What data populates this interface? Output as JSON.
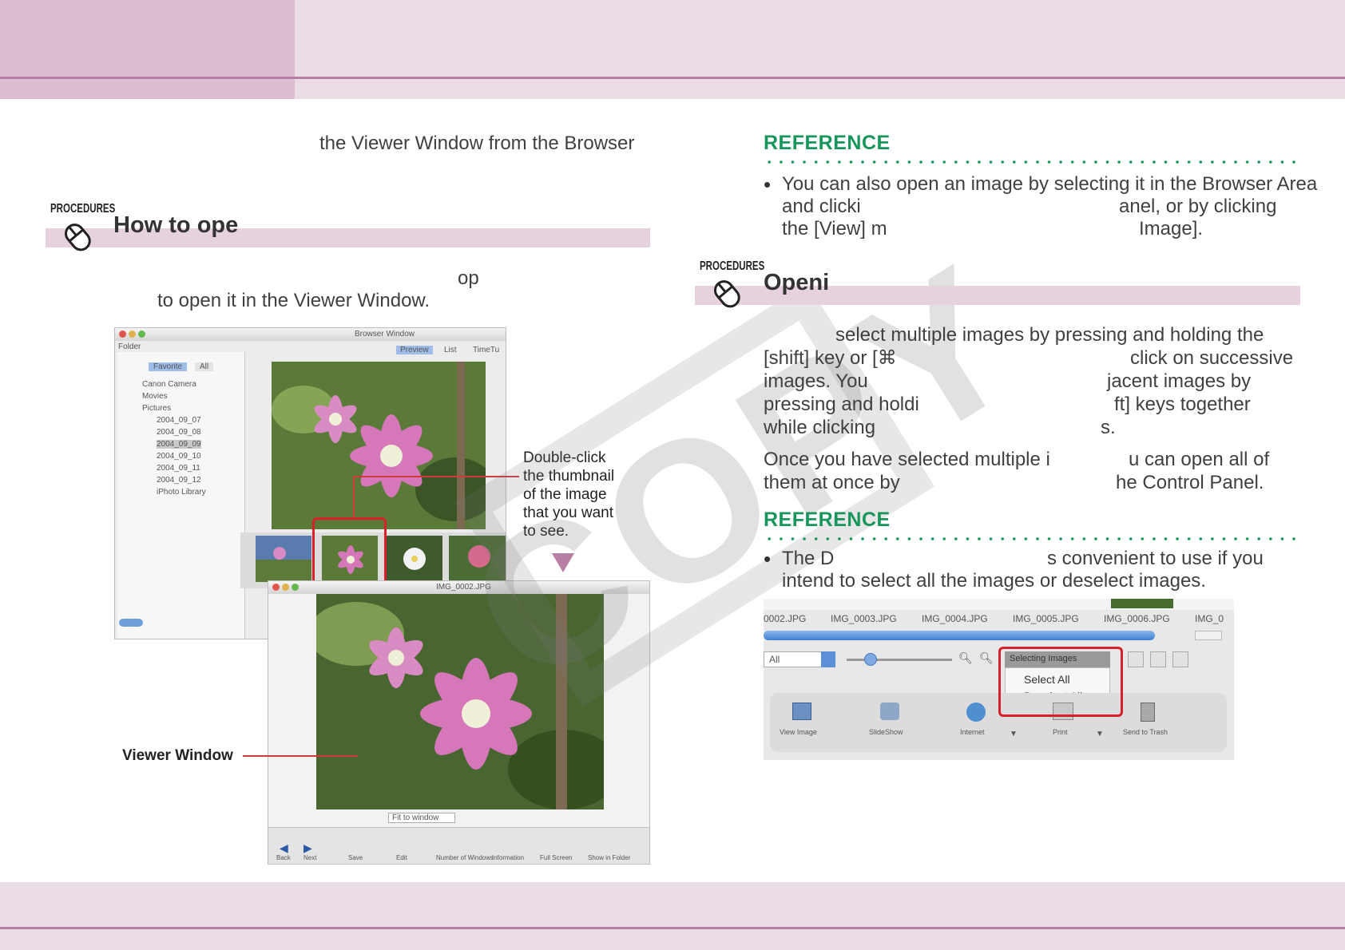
{
  "left": {
    "intro_line": "the Viewer Window from the Browser",
    "procedure_label": "PROCEDURES",
    "procedure_title": "How to ope",
    "step_line1": "op",
    "step_line2": "to open it in the Viewer Window.",
    "callout_thumbnail": "Double-click\nthe thumbnail\nof the image\nthat you want\nto see.",
    "callout_viewer": "Viewer Window",
    "browser_window": {
      "title": "Browser Window",
      "folder_label": "Folder",
      "tabs": [
        "Favorite",
        "All"
      ],
      "view_tabs": [
        "Preview",
        "List",
        "TimeTu"
      ],
      "tree": [
        "Canon Camera",
        "Movies",
        "Pictures",
        "2004_09_07",
        "2004_09_08",
        "2004_09_09",
        "2004_09_10",
        "2004_09_11",
        "2004_09_12",
        "iPhoto Library"
      ]
    },
    "viewer_window": {
      "title": "IMG_0002.JPG",
      "zoom": "Fit to window",
      "toolbar": [
        "Back",
        "Next",
        "Save",
        "Edit",
        "Number of Windows",
        "Information",
        "Full Screen",
        "Show in Folder"
      ]
    }
  },
  "right": {
    "reference1_title": "REFERENCE",
    "reference1_bullet": "•",
    "reference1_lines": [
      "You can also open an image by selecting it in the Browser Area",
      "and clicki",
      "anel, or by clicking",
      "the [View] m",
      "Image]."
    ],
    "procedure_label": "PROCEDURES",
    "procedure_title": "Openi",
    "para1": [
      "select multiple images by pressing and holding the",
      "[shift] key or [⌘",
      "click on successive",
      "images. You",
      "jacent images by",
      "pressing and holdi",
      "ft] keys together",
      "while clicking",
      "s."
    ],
    "para2": [
      "Once you have selected multiple i",
      "u can open all of",
      "them at once by",
      "he Control Panel."
    ],
    "reference2_title": "REFERENCE",
    "reference2_bullet": "•",
    "reference2_lines": [
      "The D",
      "s convenient to use if you",
      "intend to select all the images or deselect images."
    ],
    "control_panel": {
      "filenames": [
        "0002.JPG",
        "IMG_0003.JPG",
        "IMG_0004.JPG",
        "IMG_0005.JPG",
        "IMG_0006.JPG",
        "IMG_0"
      ],
      "show_select": "All",
      "menu_button": "Selecting Images",
      "menu_items": [
        "Select All",
        "Deselect All"
      ],
      "buttons": [
        "View Image",
        "SlideShow",
        "Internet",
        "Print",
        "Send to Trash"
      ]
    }
  },
  "watermark": "COPY",
  "colors": {
    "band": "#eadde6",
    "band_dark": "#ddbdd0",
    "rule": "#b77fa3",
    "reference_green": "#16965a",
    "highlight_red": "#d9202a"
  }
}
